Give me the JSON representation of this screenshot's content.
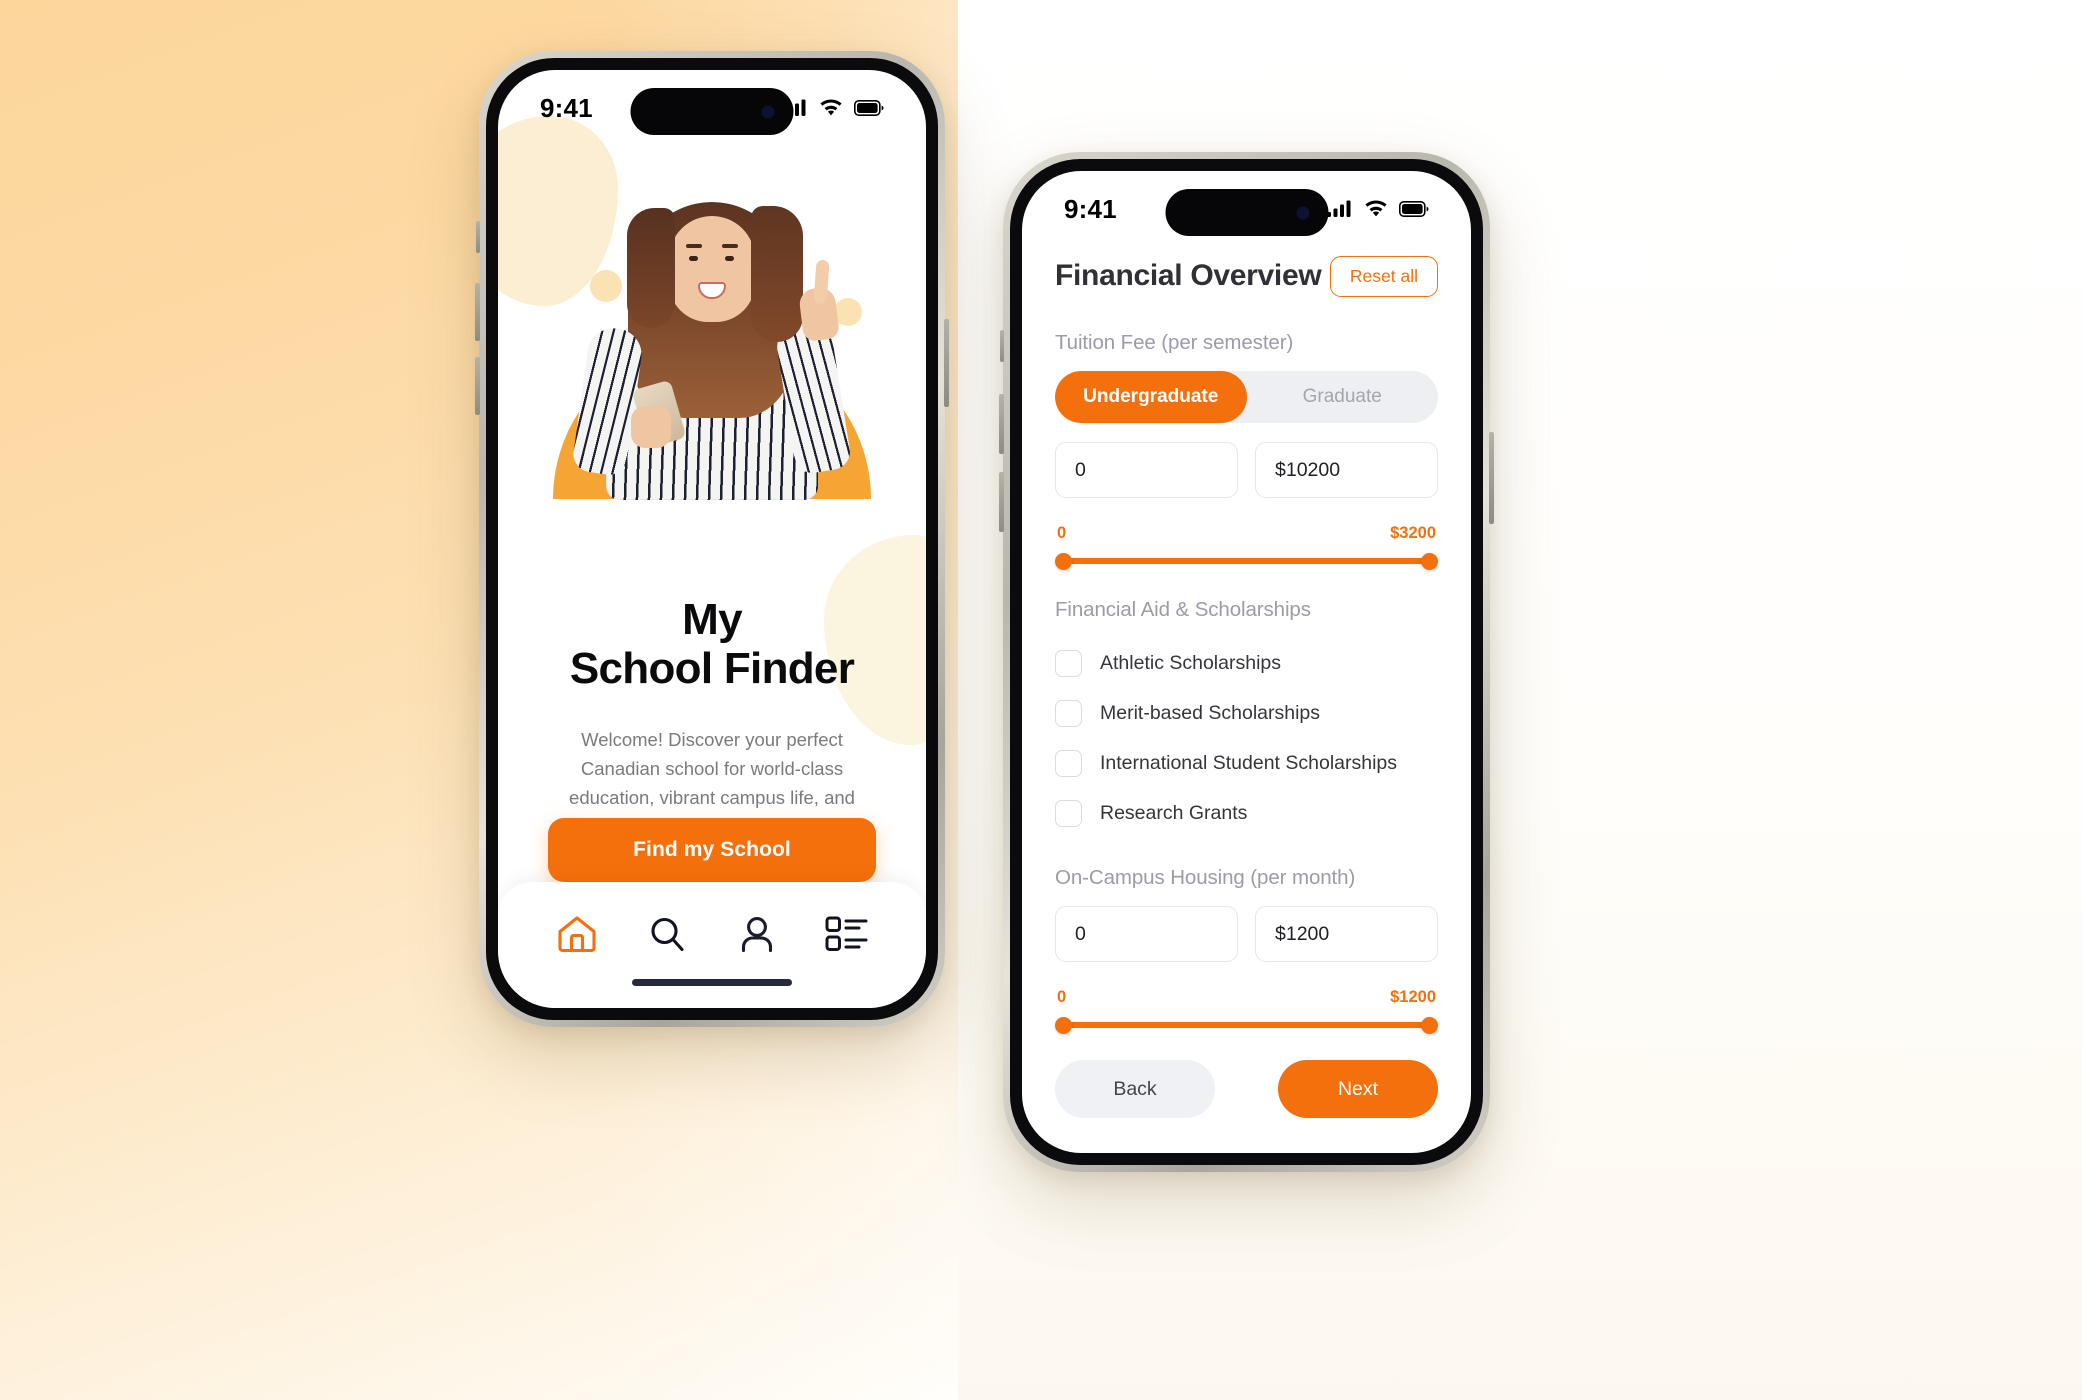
{
  "theme": {
    "accent": "#F4700C",
    "accent_soft": "#F5A534",
    "bg_warm": "#FCD69B",
    "bg_cream": "#FEFDF8",
    "muted_text": "#9B9CA8",
    "dark_text": "#0B0B0E"
  },
  "phone_left": {
    "status_bar": {
      "time": "9:41",
      "cellular_icon": "signal-bars-icon",
      "wifi_icon": "wifi-icon",
      "battery_icon": "battery-full-icon"
    },
    "hero": {
      "illustration_alt": "smiling-woman-holding-phone-pointing-up",
      "shapes": [
        "half-circle",
        "dot",
        "ring",
        "dot"
      ]
    },
    "title_line1": "My",
    "title_line2": "School Finder",
    "subtitle": "Welcome! Discover your perfect Canadian school for world-class education, vibrant campus life, and unique programs.",
    "cta_label": "Find my School",
    "tabbar": [
      {
        "icon": "home-icon",
        "name": "tab-home",
        "active": true
      },
      {
        "icon": "search-icon",
        "name": "tab-search",
        "active": false
      },
      {
        "icon": "user-icon",
        "name": "tab-profile",
        "active": false
      },
      {
        "icon": "list-icon",
        "name": "tab-list",
        "active": false
      }
    ]
  },
  "phone_right": {
    "status_bar": {
      "time": "9:41",
      "cellular_icon": "signal-bars-icon",
      "wifi_icon": "wifi-icon",
      "battery_icon": "battery-full-icon"
    },
    "header": {
      "title": "Financial Overview",
      "reset_label": "Reset all"
    },
    "tuition": {
      "section_label": "Tuition Fee  (per semester)",
      "segments": [
        {
          "label": "Undergraduate",
          "active": true
        },
        {
          "label": "Graduate",
          "active": false
        }
      ],
      "min_value": "0",
      "max_value": "$10200",
      "min_placeholder": "0",
      "max_placeholder": "$10200",
      "slider_min_label": "0",
      "slider_max_label": "$3200"
    },
    "aid": {
      "section_label": "Financial Aid & Scholarships",
      "options": [
        {
          "label": "Athletic Scholarships",
          "checked": false
        },
        {
          "label": "Merit-based Scholarships",
          "checked": false
        },
        {
          "label": "International Student Scholarships",
          "checked": false
        },
        {
          "label": "Research Grants",
          "checked": false
        }
      ]
    },
    "housing": {
      "section_label": "On-Campus Housing  (per month)",
      "min_value": "0",
      "max_value": "$1200",
      "min_placeholder": "0",
      "max_placeholder": "$1200",
      "slider_min_label": "0",
      "slider_max_label": "$1200"
    },
    "footer": {
      "back_label": "Back",
      "next_label": "Next"
    }
  }
}
